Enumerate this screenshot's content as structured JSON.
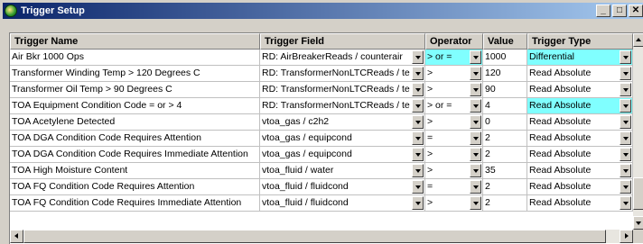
{
  "window": {
    "title": "Trigger Setup",
    "minimize_label": "_",
    "maximize_label": "□",
    "close_label": "✕"
  },
  "table": {
    "columns": [
      "Trigger Name",
      "Trigger Field",
      "Operator",
      "Value",
      "Trigger Type"
    ],
    "rows": [
      {
        "name": "Air Bkr 1000 Ops",
        "field": "RD: AirBreakerReads / counterair",
        "operator": "> or =",
        "value": "1000",
        "type": "Differential",
        "operator_hl": true,
        "type_hl": true
      },
      {
        "name": "Transformer Winding Temp > 120 Degrees C",
        "field": "RD: TransformerNonLTCReads / te",
        "operator": ">",
        "value": "120",
        "type": "Read Absolute",
        "operator_hl": false,
        "type_hl": false
      },
      {
        "name": "Transformer Oil Temp > 90 Degrees C",
        "field": "RD: TransformerNonLTCReads / te",
        "operator": ">",
        "value": "90",
        "type": "Read Absolute",
        "operator_hl": false,
        "type_hl": false
      },
      {
        "name": "TOA Equipment Condition Code = or > 4",
        "field": "RD: TransformerNonLTCReads / te",
        "operator": "> or =",
        "value": "4",
        "type": "Read Absolute",
        "operator_hl": false,
        "type_hl": true
      },
      {
        "name": "TOA Acetylene Detected",
        "field": "vtoa_gas / c2h2",
        "operator": ">",
        "value": "0",
        "type": "Read Absolute",
        "operator_hl": false,
        "type_hl": false
      },
      {
        "name": "TOA DGA Condition Code Requires Attention",
        "field": "vtoa_gas / equipcond",
        "operator": "=",
        "value": "2",
        "type": "Read Absolute",
        "operator_hl": false,
        "type_hl": false
      },
      {
        "name": "TOA DGA Condition Code Requires Immediate Attention",
        "field": "vtoa_gas / equipcond",
        "operator": ">",
        "value": "2",
        "type": "Read Absolute",
        "operator_hl": false,
        "type_hl": false
      },
      {
        "name": "TOA High Moisture Content",
        "field": "vtoa_fluid / water",
        "operator": ">",
        "value": "35",
        "type": "Read Absolute",
        "operator_hl": false,
        "type_hl": false
      },
      {
        "name": "TOA FQ Condition Code Requires Attention",
        "field": "vtoa_fluid / fluidcond",
        "operator": "=",
        "value": "2",
        "type": "Read Absolute",
        "operator_hl": false,
        "type_hl": false
      },
      {
        "name": "TOA FQ Condition Code Requires Immediate Attention",
        "field": "vtoa_fluid / fluidcond",
        "operator": ">",
        "value": "2",
        "type": "Read Absolute",
        "operator_hl": false,
        "type_hl": false
      }
    ]
  },
  "colors": {
    "highlight": "#80ffff",
    "titlebar_start": "#0a246a",
    "titlebar_end": "#a6caf0"
  }
}
